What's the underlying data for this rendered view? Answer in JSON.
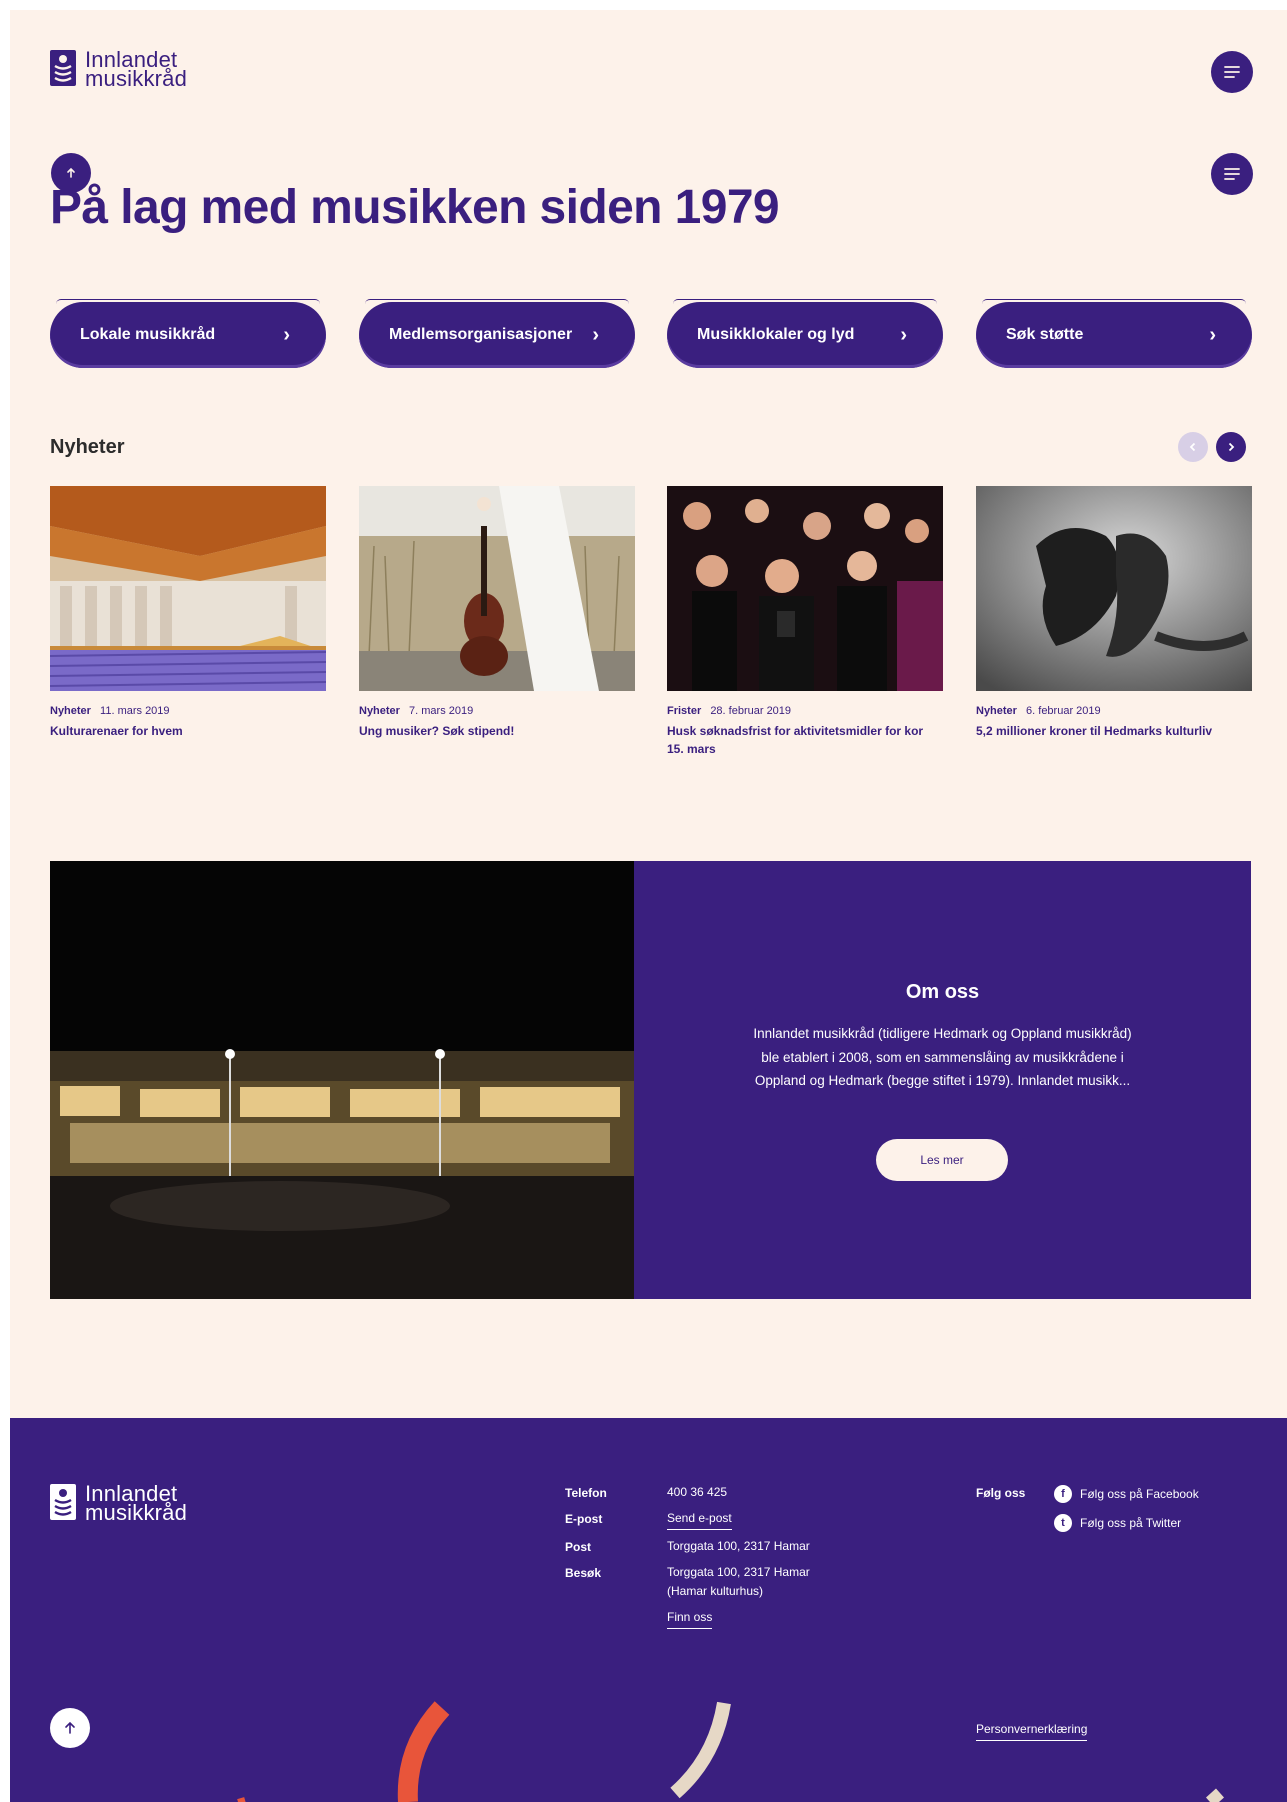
{
  "header": {
    "logo_line1": "Innlandet",
    "logo_line2": "musikkråd"
  },
  "hero": {
    "title": "På lag med musikken siden 1979"
  },
  "quick_links": [
    {
      "label": "Lokale musikkråd"
    },
    {
      "label": "Medlemsorganisasjoner"
    },
    {
      "label": "Musikklokaler og lyd"
    },
    {
      "label": "Søk støtte"
    }
  ],
  "news": {
    "heading": "Nyheter",
    "items": [
      {
        "category": "Nyheter",
        "date": "11. mars 2019",
        "title": "Kulturarenaer for hvem"
      },
      {
        "category": "Nyheter",
        "date": "7. mars 2019",
        "title": "Ung musiker? Søk stipend!"
      },
      {
        "category": "Frister",
        "date": "28. februar 2019",
        "title": "Husk søknadsfrist for aktivitetsmidler for kor 15. mars"
      },
      {
        "category": "Nyheter",
        "date": "6. februar 2019",
        "title": "5,2 millioner kroner til Hedmarks kulturliv"
      }
    ]
  },
  "about": {
    "title": "Om oss",
    "text": "Innlandet musikkråd (tidligere Hedmark og Oppland musikkråd) ble etablert i 2008, som en sammenslåing av musikkrådene i Oppland og Hedmark (begge stiftet i 1979). Innlandet musikk...",
    "button": "Les mer"
  },
  "footer": {
    "logo_line1": "Innlandet",
    "logo_line2": "musikkråd",
    "phone_label": "Telefon",
    "phone": "400 36 425",
    "email_label": "E-post",
    "email": "Send e-post",
    "post_label": "Post",
    "post": "Torggata 100, 2317 Hamar",
    "visit_label": "Besøk",
    "visit_line1": "Torggata 100, 2317 Hamar",
    "visit_line2": "(Hamar kulturhus)",
    "find_us": "Finn oss",
    "follow_label": "Følg oss",
    "facebook": "Følg oss på Facebook",
    "twitter": "Følg oss på Twitter",
    "privacy": "Personvernerklæring"
  },
  "colors": {
    "brand_purple": "#3a1f7f",
    "background_cream": "#fdf2ea",
    "accent_orange": "#e8553a",
    "accent_beige": "#e6d8c6"
  },
  "icons": {
    "menu": "menu-icon",
    "up": "arrow-up-icon",
    "prev": "chevron-left-icon",
    "next": "chevron-right-icon"
  }
}
